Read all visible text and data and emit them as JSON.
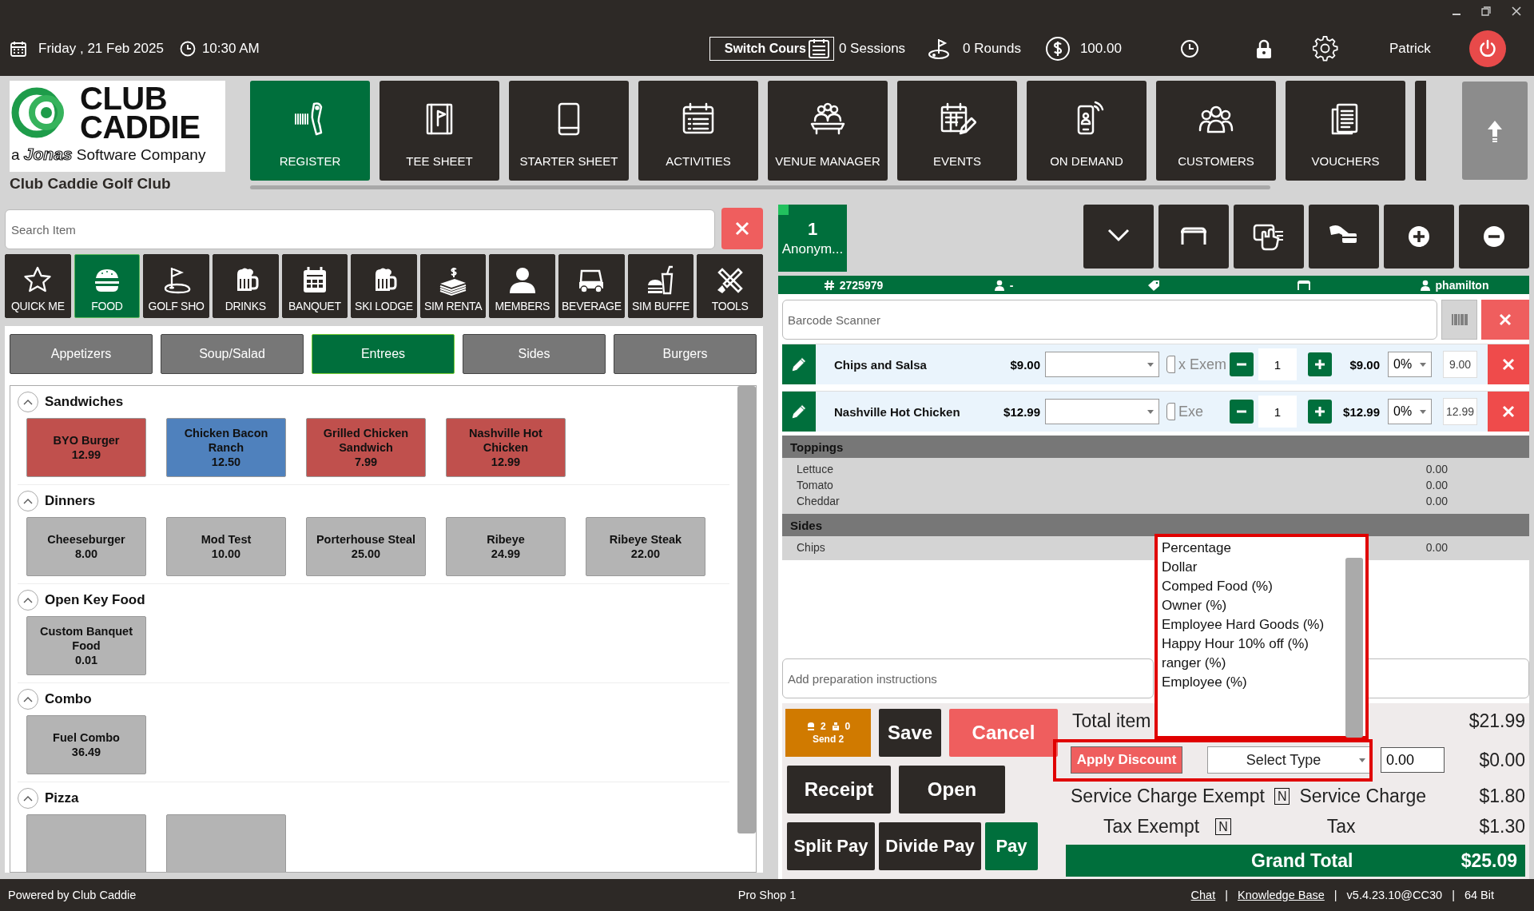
{
  "top_bar": {
    "date": "Friday , 21 Feb 2025",
    "time": "10:30 AM",
    "switch_course": "Switch Cours",
    "sessions": "0 Sessions",
    "rounds": "0 Rounds",
    "balance": "100.00",
    "user": "Patrick"
  },
  "brand": {
    "logo_text": "CLUB CADDIE",
    "tagline": "a **Jonas** Software Company",
    "club_name": "Club Caddie Golf Club"
  },
  "modules": [
    {
      "label": "REGISTER",
      "selected": true
    },
    {
      "label": "TEE SHEET",
      "selected": false
    },
    {
      "label": "STARTER SHEET",
      "selected": false
    },
    {
      "label": "ACTIVITIES",
      "selected": false
    },
    {
      "label": "VENUE MANAGER",
      "selected": false
    },
    {
      "label": "EVENTS",
      "selected": false
    },
    {
      "label": "ON DEMAND",
      "selected": false
    },
    {
      "label": "CUSTOMERS",
      "selected": false
    },
    {
      "label": "VOUCHERS",
      "selected": false
    }
  ],
  "item_panel": {
    "search": {
      "placeholder": "Search Item"
    },
    "categories": [
      {
        "label": "QUICK ME",
        "selected": false
      },
      {
        "label": "FOOD",
        "selected": true
      },
      {
        "label": "GOLF SHO",
        "selected": false
      },
      {
        "label": "DRINKS",
        "selected": false
      },
      {
        "label": "BANQUET",
        "selected": false
      },
      {
        "label": "SKI LODGE",
        "selected": false
      },
      {
        "label": "SIM RENTA",
        "selected": false
      },
      {
        "label": "MEMBERS",
        "selected": false
      },
      {
        "label": "BEVERAGE",
        "selected": false
      },
      {
        "label": "SIM BUFFE",
        "selected": false
      },
      {
        "label": "TOOLS",
        "selected": false
      }
    ],
    "subcategories": [
      {
        "label": "Appetizers",
        "selected": false
      },
      {
        "label": "Soup/Salad",
        "selected": false
      },
      {
        "label": "Entrees",
        "selected": true
      },
      {
        "label": "Sides",
        "selected": false
      },
      {
        "label": "Burgers",
        "selected": false
      }
    ],
    "groups": [
      {
        "title": "Sandwiches",
        "expanded": true,
        "items": [
          {
            "name": "BYO Burger",
            "price": "12.99",
            "color": "#c0504d"
          },
          {
            "name": "Chicken Bacon Ranch",
            "price": "12.50",
            "color": "#4f81bd"
          },
          {
            "name": "Grilled Chicken Sandwich",
            "price": "7.99",
            "color": "#c0504d"
          },
          {
            "name": "Nashville Hot Chicken",
            "price": "12.99",
            "color": "#c0504d"
          }
        ]
      },
      {
        "title": "Dinners",
        "expanded": true,
        "items": [
          {
            "name": "Cheeseburger",
            "price": "8.00",
            "color": "#b4b4b4"
          },
          {
            "name": "Mod Test",
            "price": "10.00",
            "color": "#b4b4b4"
          },
          {
            "name": "Porterhouse Steal",
            "price": "25.00",
            "color": "#b4b4b4"
          },
          {
            "name": "Ribeye",
            "price": "24.99",
            "color": "#b4b4b4"
          },
          {
            "name": "Ribeye Steak",
            "price": "22.00",
            "color": "#b4b4b4"
          }
        ]
      },
      {
        "title": "Open Key Food",
        "expanded": true,
        "items": [
          {
            "name": "Custom Banquet Food",
            "price": "0.01",
            "color": "#b4b4b4"
          }
        ]
      },
      {
        "title": "Combo",
        "expanded": true,
        "items": [
          {
            "name": "Fuel Combo",
            "price": "36.49",
            "color": "#b4b4b4"
          }
        ]
      },
      {
        "title": "Pizza",
        "expanded": true,
        "items": [
          {
            "color": "#b4b4b4"
          },
          {
            "color": "#b4b4b4"
          }
        ]
      }
    ]
  },
  "order": {
    "tab": {
      "number": "1",
      "name": "Anonym..."
    },
    "info": {
      "ticket": "2725979",
      "customer": "-",
      "server": "phamilton"
    },
    "barcode": {
      "placeholder": "Barcode Scanner"
    },
    "lines": [
      {
        "name": "Chips and Salsa",
        "price": "$9.00",
        "exempt_label": "x Exem",
        "checked": false,
        "qty": "1",
        "total": "$9.00",
        "discount": "0%",
        "amount": "9.00"
      },
      {
        "name": "Nashville Hot Chicken",
        "price": "$12.99",
        "exempt_label": "Exe",
        "checked": false,
        "qty": "1",
        "total": "$12.99",
        "discount": "0%",
        "amount": "12.99"
      }
    ],
    "modifiers": [
      {
        "title": "Toppings",
        "options": [
          {
            "name": "Lettuce",
            "price": "0.00"
          },
          {
            "name": "Tomato",
            "price": "0.00"
          },
          {
            "name": "Cheddar",
            "price": "0.00"
          }
        ]
      },
      {
        "title": "Sides",
        "options": [
          {
            "name": "Chips",
            "price": "0.00"
          }
        ]
      }
    ],
    "prep": {
      "placeholder": "Add preparation instructions"
    },
    "send": {
      "seats": "2",
      "held": "0",
      "label": "Send 2"
    },
    "buttons": [
      {
        "label": "Save",
        "kind": "dark"
      },
      {
        "label": "Cancel",
        "kind": "danger"
      },
      {
        "label": "Receipt",
        "kind": "dark"
      },
      {
        "label": "Open",
        "kind": "dark"
      },
      {
        "label": "Split Pay",
        "kind": "dark"
      },
      {
        "label": "Divide Pay",
        "kind": "dark"
      },
      {
        "label": "Pay",
        "kind": "success"
      }
    ],
    "totals": {
      "items_label": "Total item",
      "items_value": "$21.99",
      "apply_button": "Apply Discount",
      "discount_type": "Select Type",
      "discount_amount": "0.00",
      "discount_value": "$0.00",
      "service_exempt_label": "Service Charge Exempt",
      "service_exempt_flag": "N",
      "service_label": "Service Charge",
      "service_value": "$1.80",
      "tax_exempt_label": "Tax Exempt",
      "tax_exempt_flag": "N",
      "tax_label": "Tax",
      "tax_value": "$1.30",
      "grand_label": "Grand Total",
      "grand_value": "$25.09"
    }
  },
  "discount_menu": {
    "options": [
      "Percentage",
      "Dollar",
      "Comped Food (%)",
      "Owner (%)",
      "Employee Hard Goods (%)",
      "Happy Hour 10% off (%)",
      "ranger (%)",
      "Employee (%)"
    ]
  },
  "footer": {
    "left": "Powered by Club Caddie",
    "center": "Pro Shop 1",
    "right": [
      {
        "kind": "link",
        "text": "Chat"
      },
      {
        "kind": "sep",
        "text": "|"
      },
      {
        "kind": "link",
        "text": "Knowledge Base"
      },
      {
        "kind": "sep",
        "text": "|"
      },
      {
        "kind": "text",
        "text": "v5.4.23.10@CC30"
      },
      {
        "kind": "sep",
        "text": "|"
      },
      {
        "kind": "text",
        "text": "64 Bit"
      }
    ]
  }
}
